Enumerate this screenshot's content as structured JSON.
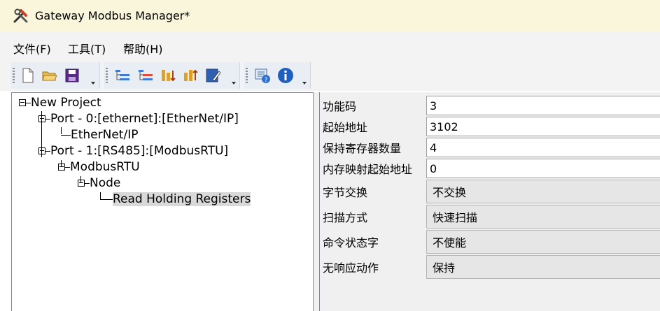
{
  "window": {
    "title": "Gateway Modbus Manager*"
  },
  "menu": {
    "items": [
      "文件(F)",
      "工具(T)",
      "帮助(H)"
    ]
  },
  "toolbar": {
    "group1": [
      "new-file-icon",
      "open-folder-icon",
      "save-icon"
    ],
    "group2": [
      "add-port-icon",
      "remove-port-icon",
      "add-node-icon",
      "add-command-icon",
      "edit-icon"
    ],
    "group3": [
      "settings-help-icon",
      "info-icon"
    ]
  },
  "tree": {
    "root": "New Project",
    "port0": "Port - 0:[ethernet]:[EtherNet/IP]",
    "ethernetip": "EtherNet/IP",
    "port1": "Port - 1:[RS485]:[ModbusRTU]",
    "modbusrtu": "ModbusRTU",
    "node": "Node",
    "command": "Read Holding Registers"
  },
  "properties": [
    {
      "label": "功能码",
      "value": "3"
    },
    {
      "label": "起始地址",
      "value": "3102"
    },
    {
      "label": "保持寄存器数量",
      "value": "4"
    },
    {
      "label": "内存映射起始地址",
      "value": "0"
    },
    {
      "label": "字节交换",
      "value": "不交换"
    },
    {
      "label": "扫描方式",
      "value": "快速扫描"
    },
    {
      "label": "命令状态字",
      "value": "不使能"
    },
    {
      "label": "无响应动作",
      "value": "保持"
    }
  ]
}
